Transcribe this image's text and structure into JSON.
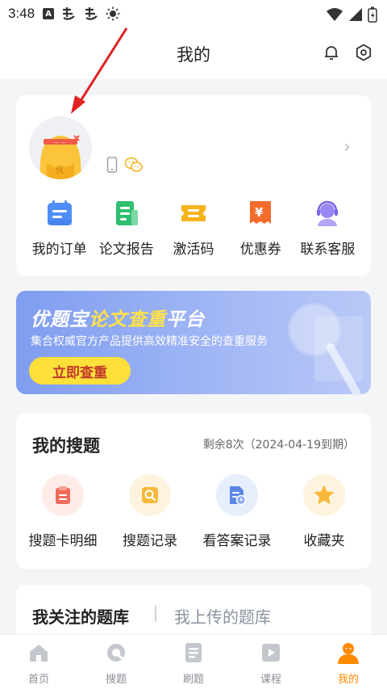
{
  "status_bar": {
    "time": "3:48",
    "icons": [
      "a-icon",
      "notification-icon",
      "notification-icon",
      "brightness-icon",
      "wifi-icon",
      "signal-icon",
      "battery-icon"
    ]
  },
  "header": {
    "title": "我的",
    "bell_icon": "bell-icon",
    "settings_icon": "gear-icon"
  },
  "profile": {
    "avatar_text": "优",
    "quick_actions": [
      {
        "label": "我的订单",
        "icon": "order-icon"
      },
      {
        "label": "论文报告",
        "icon": "report-icon"
      },
      {
        "label": "激活码",
        "icon": "activation-code-icon"
      },
      {
        "label": "优惠券",
        "icon": "coupon-icon"
      },
      {
        "label": "联系客服",
        "icon": "customer-service-icon"
      }
    ]
  },
  "banner": {
    "title_prefix": "优题宝",
    "title_highlight": "论文查重",
    "title_suffix": "平台",
    "subtitle": "集合权威官方产品提供高效精准安全的查重服务",
    "button_label": "立即查重"
  },
  "my_search": {
    "title": "我的搜题",
    "remaining": "剩余8次（2024-04-19到期）",
    "items": [
      {
        "label": "搜题卡明细",
        "icon": "card-detail-icon",
        "bg": "#fdece8",
        "color": "#f16b5b"
      },
      {
        "label": "搜题记录",
        "icon": "search-record-icon",
        "bg": "#fdf3df",
        "color": "#f6b93b"
      },
      {
        "label": "看答案记录",
        "icon": "answer-record-icon",
        "bg": "#e7eefc",
        "color": "#5b86e5"
      },
      {
        "label": "收藏夹",
        "icon": "star-icon",
        "bg": "#fdf3df",
        "color": "#f6b93b"
      }
    ]
  },
  "question_bank": {
    "tab_followed": "我关注的题库",
    "tab_uploaded": "我上传的题库"
  },
  "bottom_nav": {
    "items": [
      {
        "label": "首页",
        "icon": "home-icon"
      },
      {
        "label": "搜题",
        "icon": "search-icon"
      },
      {
        "label": "刷题",
        "icon": "practice-icon"
      },
      {
        "label": "课程",
        "icon": "course-icon"
      },
      {
        "label": "我的",
        "icon": "profile-icon"
      }
    ],
    "active_index": 4
  },
  "colors": {
    "accent": "#ff8a00",
    "banner_yellow": "#fde03a",
    "arrow_red": "#e02222"
  }
}
